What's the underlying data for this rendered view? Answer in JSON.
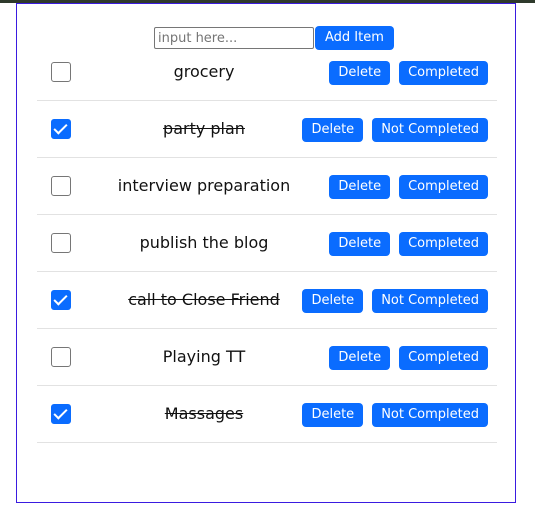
{
  "form": {
    "placeholder": "input here...",
    "add_label": "Add Item"
  },
  "todos": [
    {
      "text": "grocery",
      "completed": false,
      "delete_label": "Delete",
      "toggle_label": "Completed"
    },
    {
      "text": "party plan",
      "completed": true,
      "delete_label": "Delete",
      "toggle_label": "Not Completed"
    },
    {
      "text": "interview preparation",
      "completed": false,
      "delete_label": "Delete",
      "toggle_label": "Completed"
    },
    {
      "text": "publish the blog",
      "completed": false,
      "delete_label": "Delete",
      "toggle_label": "Completed"
    },
    {
      "text": "call to Close Friend",
      "completed": true,
      "delete_label": "Delete",
      "toggle_label": "Not Completed"
    },
    {
      "text": "Playing TT",
      "completed": false,
      "delete_label": "Delete",
      "toggle_label": "Completed"
    },
    {
      "text": "Massages",
      "completed": true,
      "delete_label": "Delete",
      "toggle_label": "Not Completed"
    }
  ],
  "colors": {
    "button": "#0a6cff",
    "border": "#3a1be0"
  }
}
